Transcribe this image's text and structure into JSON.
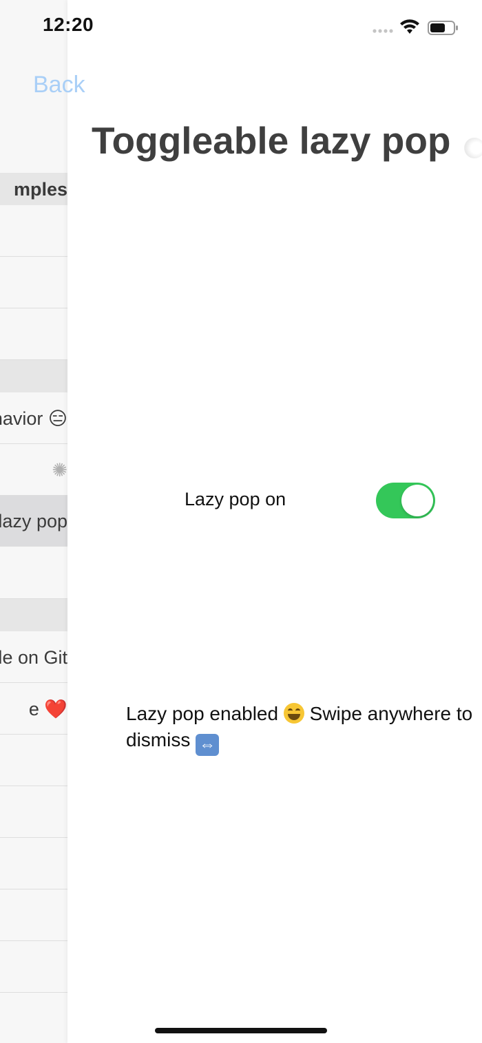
{
  "status_bar": {
    "time": "12:20",
    "battery_level": 0.65
  },
  "background_list": {
    "headers": [
      {
        "label": "mples"
      },
      {
        "label": ""
      },
      {
        "label": ""
      }
    ],
    "rows": [
      {
        "label": ""
      },
      {
        "label": ""
      },
      {
        "label": ""
      },
      {
        "label": "havior 😑"
      },
      {
        "label": "✺"
      },
      {
        "label": "lazy pop",
        "selected": true
      },
      {
        "label": ""
      },
      {
        "label": "de on Git"
      },
      {
        "label": "e ❤️"
      },
      {
        "label": ""
      },
      {
        "label": ""
      },
      {
        "label": ""
      },
      {
        "label": ""
      },
      {
        "label": ""
      }
    ]
  },
  "nav": {
    "back_label": "Back",
    "title": "Toggleable lazy pop"
  },
  "toggle": {
    "label": "Lazy pop on",
    "on": true,
    "on_color": "#34c759"
  },
  "message": {
    "part1": "Lazy pop enabled ",
    "part2": " Swipe anywhere to dismiss "
  },
  "colors": {
    "back_link": "#a9cff7",
    "title": "#3f3f3f"
  }
}
